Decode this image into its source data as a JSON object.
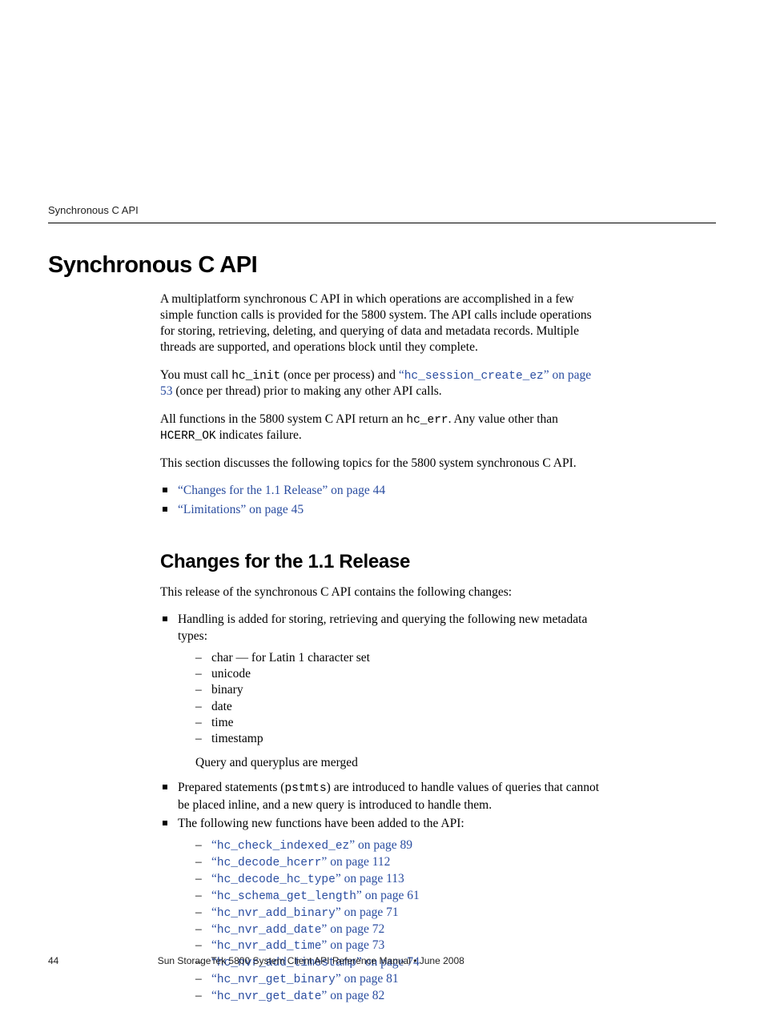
{
  "runningHead": "Synchronous C API",
  "h1": "Synchronous C API",
  "para1a": "A multiplatform synchronous C API in which operations are accomplished in a few simple function calls is provided for the 5800 system. The API calls include operations for storing, retrieving, deleting, and querying of data and metadata records. Multiple threads are supported, and operations block until they complete.",
  "para2_pre": "You must call ",
  "para2_code1": "hc_init",
  "para2_mid": " (once per process) and ",
  "para2_linkcode": "hc_session_create_ez",
  "para2_linktail": " on page 53",
  "para2_post": " (once per thread) prior to making any other API calls.",
  "para3_pre": "All functions in the 5800 system C API return an ",
  "para3_code1": "hc_err",
  "para3_mid": ". Any value other than ",
  "para3_code2": "HCERR_OK",
  "para3_post": " indicates failure.",
  "para4": "This section discusses the following topics for the 5800 system synchronous C API.",
  "toc": [
    {
      "label": "“Changes for the 1.1 Release” on page 44"
    },
    {
      "label": "“Limitations” on page 45"
    }
  ],
  "h2": "Changes for the 1.1 Release",
  "para5": "This release of the synchronous C API contains the following changes:",
  "bullet1": "Handling is added for storing, retrieving and querying the following new metadata types:",
  "types": [
    "char — for Latin 1 character set",
    "unicode",
    "binary",
    "date",
    "time",
    "timestamp"
  ],
  "mergedNote": "Query and queryplus are merged",
  "bullet2_pre": "Prepared statements (",
  "bullet2_code": "pstmts",
  "bullet2_post": ") are introduced to handle values of queries that cannot be placed inline, and a new query is introduced to handle them.",
  "bullet3": "The following new functions have been added to the API:",
  "funcs": [
    {
      "code": "hc_check_indexed_ez",
      "tail": " on page 89"
    },
    {
      "code": "hc_decode_hcerr",
      "tail": " on page 112"
    },
    {
      "code": "hc_decode_hc_type",
      "tail": " on page 113"
    },
    {
      "code": "hc_schema_get_length",
      "tail": " on page 61"
    },
    {
      "code": "hc_nvr_add_binary",
      "tail": " on page 71"
    },
    {
      "code": "hc_nvr_add_date",
      "tail": " on page 72"
    },
    {
      "code": "hc_nvr_add_time",
      "tail": " on page 73"
    },
    {
      "code": "hc_nvr_add_timestamp",
      "tail": " on page 74"
    },
    {
      "code": "hc_nvr_get_binary",
      "tail": " on page 81"
    },
    {
      "code": "hc_nvr_get_date",
      "tail": " on page 82"
    }
  ],
  "footer": {
    "pageNum": "44",
    "pub": "Sun StorageTek 5800 System Client API Reference Manual  •  June 2008"
  }
}
